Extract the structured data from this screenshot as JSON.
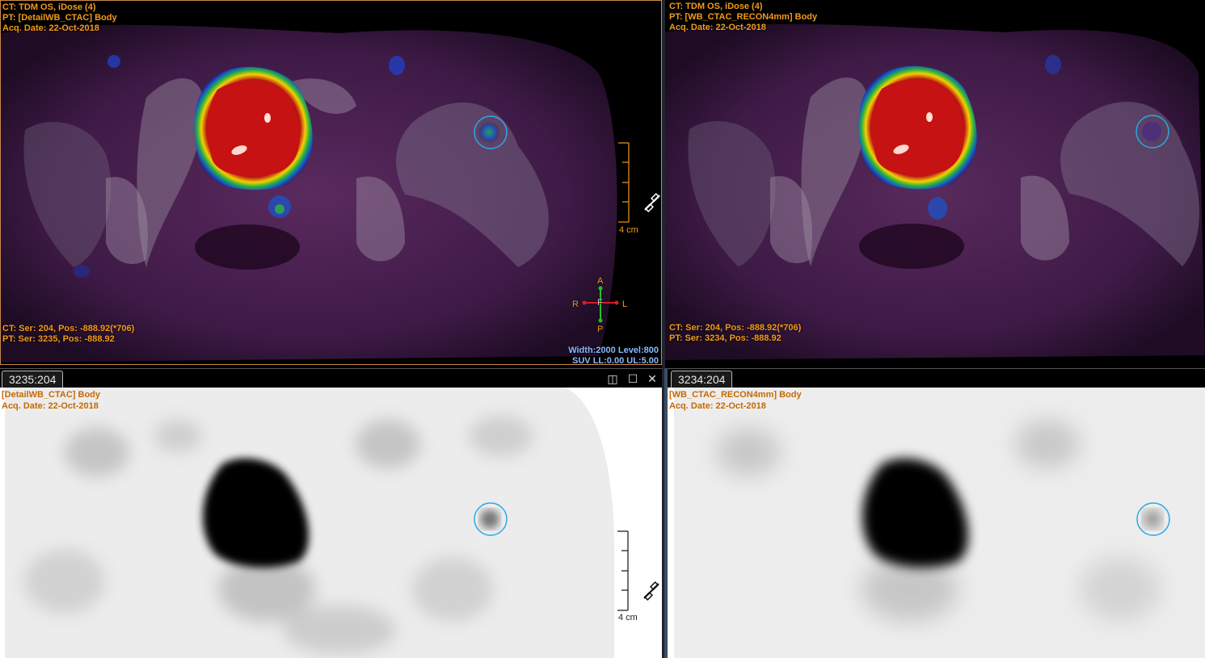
{
  "top_left": {
    "header": [
      "CT: TDM OS, iDose (4)",
      "PT: [DetailWB_CTAC] Body",
      "Acq. Date: 22-Oct-2018"
    ],
    "footer": [
      "CT: Ser: 204,  Pos: -888.92(*706)",
      "PT: Ser: 3235,  Pos: -888.92"
    ],
    "window": [
      "Width:2000 Level:800",
      "SUV LL:0.00 UL:5.00"
    ],
    "scale_label": "4 cm",
    "orientation": {
      "top": "A",
      "bottom": "P",
      "left": "R",
      "right": "L",
      "center": "F"
    }
  },
  "top_right": {
    "header": [
      "CT: TDM OS, iDose (4)",
      "PT: [WB_CTAC_RECON4mm] Body",
      "Acq. Date: 22-Oct-2018"
    ],
    "footer": [
      "CT: Ser: 204,  Pos: -888.92(*706)",
      "PT: Ser: 3234,  Pos: -888.92"
    ]
  },
  "bottom_left": {
    "tab": "3235:204",
    "header": [
      "[DetailWB_CTAC] Body",
      "Acq. Date: 22-Oct-2018"
    ],
    "scale_label": "4 cm"
  },
  "bottom_right": {
    "tab": "3234:204",
    "header": [
      "[WB_CTAC_RECON4mm] Body",
      "Acq. Date: 22-Oct-2018"
    ]
  },
  "window_controls": {
    "restore": "◫",
    "maximize": "☐",
    "close": "✕"
  },
  "icons": {
    "link": "link-icon",
    "orientation": "orientation-marker-icon"
  },
  "colors": {
    "overlay_text": "#f39a1a",
    "roi_circle": "#2aa8e8",
    "window_text": "#8ab8ff",
    "active_border": "#c98a4a"
  }
}
